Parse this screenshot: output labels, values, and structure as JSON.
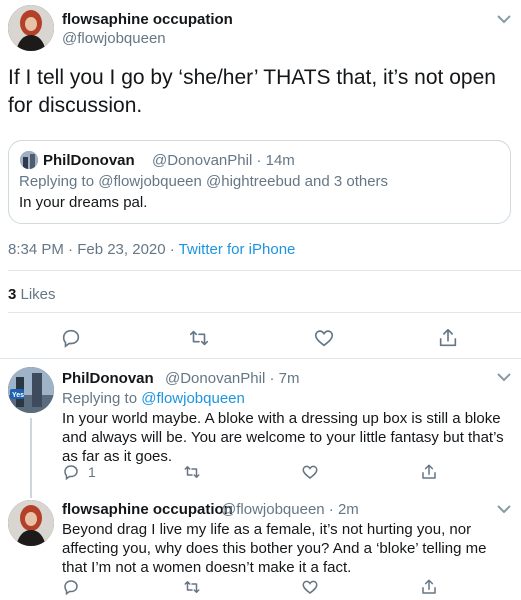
{
  "main_tweet": {
    "display_name": "flowsaphine occupation",
    "handle": "@flowjobqueen",
    "text": "If I tell you I go by ‘she/her’ THATS that, it’s not open for discussion.",
    "timestamp": "8:34 PM · Feb 23, 2020 · ",
    "source": "Twitter for iPhone",
    "likes_count": "3",
    "likes_label": " Likes"
  },
  "quoted_tweet": {
    "display_name": "PhilDonovan",
    "handle_time": "@DonovanPhil · 14m",
    "replying_prefix": "Replying to ",
    "replying_to": "@flowjobqueen @hightreebud",
    "replying_suffix": " and 3 others",
    "text": "In your dreams pal."
  },
  "replies": [
    {
      "display_name": "PhilDonovan",
      "handle_time": "@DonovanPhil · 7m",
      "replying_prefix": "Replying to ",
      "replying_to": "@flowjobqueen",
      "text": "In your world maybe. A bloke with a dressing up box is still a bloke and always will be. You are welcome to your little fantasy but that’s as far as it goes.",
      "reply_count": "1",
      "avatar_badge": "Yes"
    },
    {
      "display_name": "flowsaphine occupation",
      "handle_time": "@flowjobqueen · 2m",
      "text": "Beyond drag I live my life as a female, it’s not hurting you, nor affecting you, why does this bother you? And a ‘bloke’ telling me that I’m not a women doesn’t make it a fact."
    }
  ],
  "icons": {
    "reply": "reply-icon",
    "retweet": "retweet-icon",
    "like": "heart-icon",
    "share": "share-icon",
    "menu": "chevron-down-icon"
  },
  "colors": {
    "accent": "#1b95e0",
    "text": "#14171a",
    "muted": "#657786",
    "divider": "#e1e8ed"
  }
}
